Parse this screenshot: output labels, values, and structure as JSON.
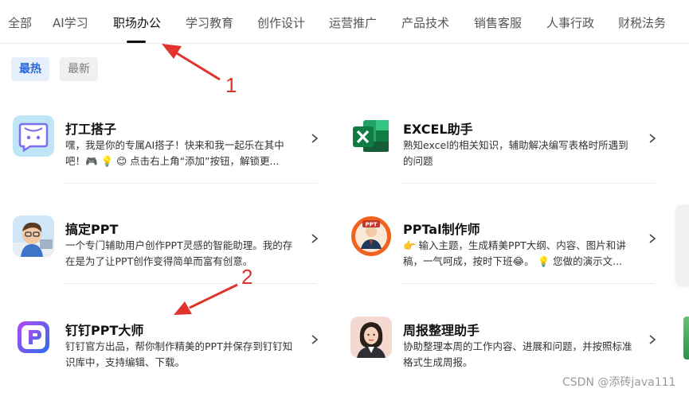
{
  "tabs": [
    "全部",
    "AI学习",
    "职场办公",
    "学习教育",
    "创作设计",
    "运营推广",
    "产品技术",
    "销售客服",
    "人事行政",
    "财税法务"
  ],
  "active_tab": "职场办公",
  "filters": {
    "hot": "最热",
    "new": "最新",
    "selected": "最热"
  },
  "cards": [
    {
      "name": "打工搭子",
      "desc": "嘿，我是你的专属AI搭子！快来和我一起乐在其中吧！🎮 💡 😊 点击右上角“添加”按钮，解锁更...",
      "icon": "chat-bubble-icon"
    },
    {
      "name": "EXCEL助手",
      "desc": "熟知excel的相关知识，辅助解决编写表格时所遇到的问题",
      "icon": "excel-icon"
    },
    {
      "name": "搞定PPT",
      "desc": "一个专门辅助用户创作PPT灵感的智能助理。我的存在是为了让PPT创作变得简单而富有创意。",
      "icon": "cartoon-boy-avatar"
    },
    {
      "name": "PPTal制作师",
      "desc": "👉 输入主题，生成精美PPT大纲、内容、图片和讲稿，一气呵成，按时下班😂。 💡 您做的演示文...",
      "icon": "ppt-badge-avatar"
    },
    {
      "name": "钉钉PPT大师",
      "desc": "钉钉官方出品，帮你制作精美的PPT并保存到钉钉知识库中，支持编辑、下载。",
      "icon": "dingtalk-ppt-icon"
    },
    {
      "name": "周报整理助手",
      "desc": "协助整理本周的工作内容、进展和问题，并按照标准格式生成周报。",
      "icon": "woman-avatar"
    }
  ],
  "annotations": {
    "label_1": "1",
    "label_2": "2"
  },
  "watermark": "CSDN @添砖java111",
  "colors": {
    "accent": "#2668dc",
    "arrow": "#e0332b"
  }
}
